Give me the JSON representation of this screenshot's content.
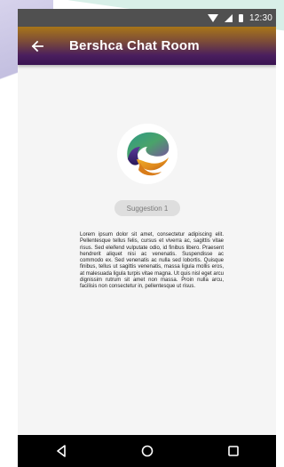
{
  "status_bar": {
    "time": "12:30",
    "icons": [
      "wifi-icon",
      "signal-icon",
      "battery-icon"
    ]
  },
  "app_bar": {
    "back_icon": "arrow-left-icon",
    "title": "Bershca Chat Room"
  },
  "content": {
    "logo_icon": "chat-swirl-logo",
    "suggestion_chip": "Suggestion 1",
    "body_text": "Lorem ipsum dolor sit amet, consectetur adipiscing elit. Pellentesque tellus felis, cursus et viverra ac, sagittis vitae risus. Sed eleifend vulputate odio, id finibus libero. Praesent hendrerit aliquet nisi ac venenatis. Suspendisse ac commodo ex. Sed venenatis ac nulla sed lobortis. Quisque finibus, tellus ut sagittis venenatis, massa ligula mollis eros, at malesuada ligula turpis vitae magna. Ut quis nisl eget arcu dignissim rutrum sit amet non massa. Proin nulla arcu, facilisis non consectetur in, pellentesque ut risus."
  },
  "nav_bar": {
    "icons": [
      "back-triangle-icon",
      "home-circle-icon",
      "recents-square-icon"
    ]
  },
  "colors": {
    "app_bar_top": "#a87618",
    "app_bar_bottom": "#3a1452",
    "status_bar": "#505050",
    "background": "#f5f5f5",
    "chip": "#dedede"
  }
}
